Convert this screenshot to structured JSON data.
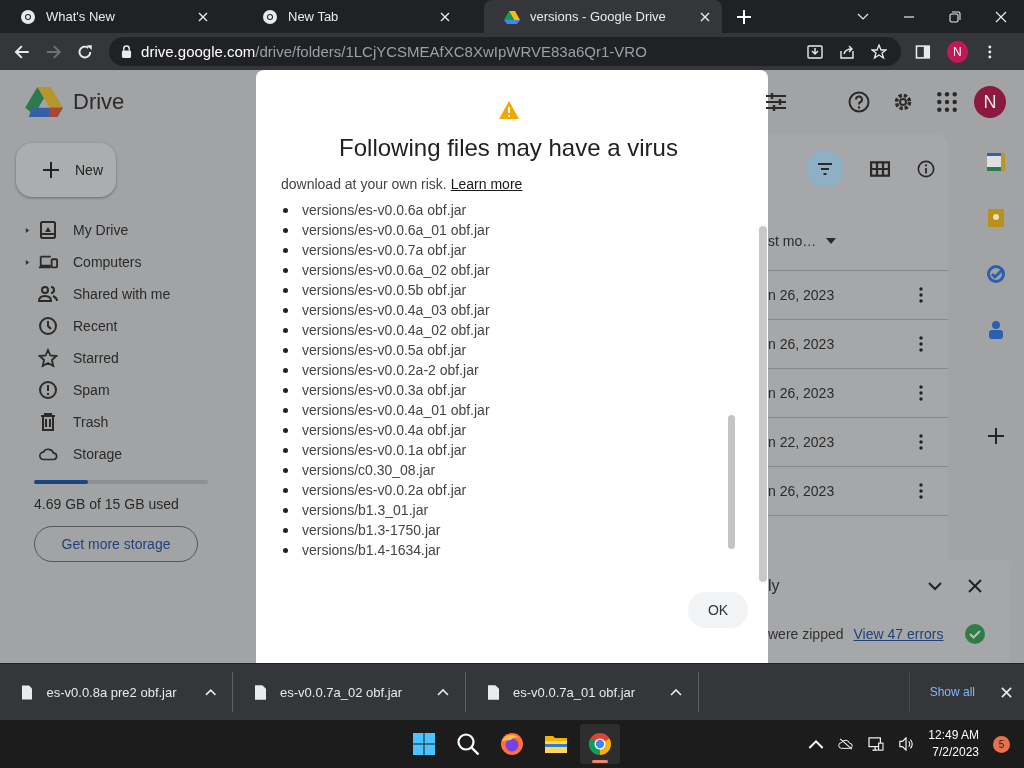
{
  "browser": {
    "tabs": [
      {
        "title": "What's New",
        "kind": "chrome",
        "selected": false
      },
      {
        "title": "New Tab",
        "kind": "chrome",
        "selected": false
      },
      {
        "title": "versions - Google Drive",
        "kind": "drive",
        "selected": true
      }
    ],
    "nav_buttons": [
      {
        "kind": "back",
        "disabled": false
      },
      {
        "kind": "forward",
        "disabled": true
      },
      {
        "kind": "reload",
        "disabled": false
      }
    ],
    "address": {
      "host": "drive.google.com",
      "path": "/drive/folders/1LCjYCSMEAfXC8XwIpWRVE83a6Qr1-VRO"
    },
    "profile_initial": "N"
  },
  "drive": {
    "product": "Drive",
    "new_button": "New",
    "nav": [
      {
        "label": "My Drive",
        "kind": "my-drive",
        "expandable": true
      },
      {
        "label": "Computers",
        "kind": "computers",
        "expandable": true
      },
      {
        "label": "Shared with me",
        "kind": "shared",
        "expandable": false
      },
      {
        "label": "Recent",
        "kind": "recent",
        "expandable": false
      },
      {
        "label": "Starred",
        "kind": "starred",
        "expandable": false
      },
      {
        "label": "Spam",
        "kind": "spam",
        "expandable": false
      },
      {
        "label": "Trash",
        "kind": "trash",
        "expandable": false
      },
      {
        "label": "Storage",
        "kind": "storage",
        "expandable": false
      }
    ],
    "storage": {
      "level": 0.31,
      "text": "4.69 GB of 15 GB used"
    },
    "get_more_storage": "Get more storage",
    "avatar": "N",
    "filter_active": true,
    "sort_column": "st mo…",
    "rows": [
      {
        "date": "n 26, 2023"
      },
      {
        "date": "n 26, 2023"
      },
      {
        "date": "n 26, 2023"
      },
      {
        "date": "n 22, 2023"
      },
      {
        "date": "n 26, 2023"
      }
    ],
    "notification": {
      "title": "ly",
      "message": "were zipped",
      "link": "View 47 errors"
    }
  },
  "dialog": {
    "title": "Following files may have a virus",
    "intro": "download at your own risk.",
    "link": "Learn more",
    "files": [
      "versions/es-v0.0.6a obf.jar",
      "versions/es-v0.0.6a_01 obf.jar",
      "versions/es-v0.0.7a obf.jar",
      "versions/es-v0.0.6a_02 obf.jar",
      "versions/es-v0.0.5b obf.jar",
      "versions/es-v0.0.4a_03 obf.jar",
      "versions/es-v0.0.4a_02 obf.jar",
      "versions/es-v0.0.5a obf.jar",
      "versions/es-v0.0.2a-2 obf.jar",
      "versions/es-v0.0.3a obf.jar",
      "versions/es-v0.0.4a_01 obf.jar",
      "versions/es-v0.0.4a obf.jar",
      "versions/es-v0.0.1a obf.jar",
      "versions/c0.30_08.jar",
      "versions/es-v0.0.2a obf.jar",
      "versions/b1.3_01.jar",
      "versions/b1.3-1750.jar",
      "versions/b1.4-1634.jar"
    ],
    "ok": "OK"
  },
  "downloads": {
    "items": [
      {
        "name": "es-v0.0.8a pre2 obf.jar"
      },
      {
        "name": "es-v0.0.7a_02 obf.jar"
      },
      {
        "name": "es-v0.0.7a_01 obf.jar"
      }
    ],
    "show_all": "Show all"
  },
  "taskbar": {
    "apps": [
      {
        "kind": "start",
        "active": false
      },
      {
        "kind": "search",
        "active": false
      },
      {
        "kind": "firefox",
        "active": false
      },
      {
        "kind": "files",
        "active": false
      },
      {
        "kind": "chrome",
        "active": true
      }
    ],
    "time": "12:49 AM",
    "date": "7/2/2023",
    "notifications": "5"
  }
}
